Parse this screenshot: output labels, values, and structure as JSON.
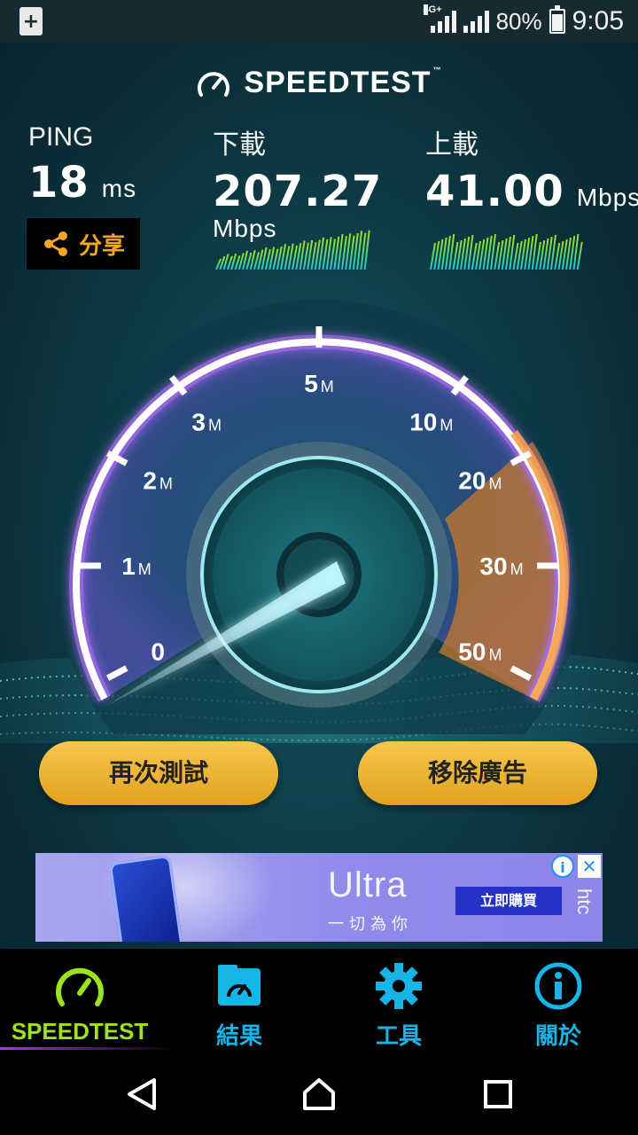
{
  "status_bar": {
    "network_label": "4G+",
    "battery": "80%",
    "time": "9:05",
    "notification_icon": "battery-saver-icon"
  },
  "app": {
    "logo_text": "SPEEDTEST",
    "logo_tm": "™"
  },
  "stats": {
    "ping": {
      "label": "PING",
      "value": "18",
      "unit": "ms"
    },
    "download": {
      "label": "下載",
      "value": "207.27",
      "unit": "Mbps"
    },
    "upload": {
      "label": "上載",
      "value": "41.00",
      "unit": "Mbps"
    }
  },
  "share_button": {
    "label": "分享",
    "icon": "share-icon"
  },
  "gauge": {
    "labels": [
      {
        "num": "0",
        "unit": ""
      },
      {
        "num": "1",
        "unit": "M"
      },
      {
        "num": "2",
        "unit": "M"
      },
      {
        "num": "3",
        "unit": "M"
      },
      {
        "num": "5",
        "unit": "M"
      },
      {
        "num": "10",
        "unit": "M"
      },
      {
        "num": "20",
        "unit": "M"
      },
      {
        "num": "30",
        "unit": "M"
      },
      {
        "num": "50",
        "unit": "M"
      }
    ]
  },
  "buttons": {
    "retest": "再次測試",
    "remove_ads": "移除廣告"
  },
  "ad": {
    "title": "Ultra",
    "subtitle": "一切為你",
    "cta": "立即購買",
    "brand": "htc",
    "info_icon": "info-icon",
    "close_icon": "close-icon"
  },
  "tabs": [
    {
      "label": "SPEEDTEST",
      "icon": "speedometer-icon",
      "active": true
    },
    {
      "label": "結果",
      "icon": "results-folder-icon",
      "active": false
    },
    {
      "label": "工具",
      "icon": "gear-icon",
      "active": false
    },
    {
      "label": "關於",
      "icon": "info-icon",
      "active": false
    }
  ],
  "colors": {
    "accent_orange": "#f5a623",
    "accent_green": "#9be31c",
    "accent_blue": "#17b4e8",
    "gauge_arc": "#ffffff",
    "gauge_glow": "#a86cf0"
  }
}
